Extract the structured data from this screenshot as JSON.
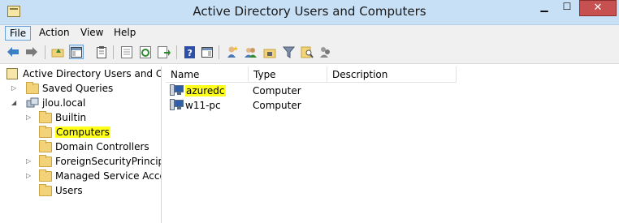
{
  "window": {
    "title": "Active Directory Users and Computers",
    "minimize_glyph": "▁",
    "maximize_glyph": "☐",
    "close_glyph": "✕"
  },
  "menu": {
    "items": [
      "File",
      "Action",
      "View",
      "Help"
    ]
  },
  "toolbar": {
    "icons": [
      "back-arrow-icon",
      "forward-arrow-icon",
      "up-folder-icon",
      "show-hide-console-tree-icon",
      "properties-icon",
      "export-list-icon",
      "refresh-icon",
      "export-icon",
      "help-icon",
      "show-action-pane-icon",
      "new-user-icon",
      "new-group-icon",
      "new-ou-icon",
      "filter-icon",
      "find-icon",
      "add-to-group-icon"
    ]
  },
  "tree": {
    "root_label": "Active Directory Users and Com",
    "items": [
      {
        "label": "Saved Queries"
      },
      {
        "label": "jlou.local"
      },
      {
        "label": "Builtin"
      },
      {
        "label": "Computers"
      },
      {
        "label": "Domain Controllers"
      },
      {
        "label": "ForeignSecurityPrincipals"
      },
      {
        "label": "Managed Service Accour"
      },
      {
        "label": "Users"
      }
    ]
  },
  "list": {
    "columns": [
      "Name",
      "Type",
      "Description"
    ],
    "rows": [
      {
        "name": "azuredc",
        "type": "Computer",
        "description": ""
      },
      {
        "name": "w11-pc",
        "type": "Computer",
        "description": ""
      }
    ]
  },
  "colors": {
    "titlebar": "#c8e0f6",
    "close_button": "#c75050",
    "highlight": "#ffff1a",
    "folder": "#f3d37a"
  }
}
